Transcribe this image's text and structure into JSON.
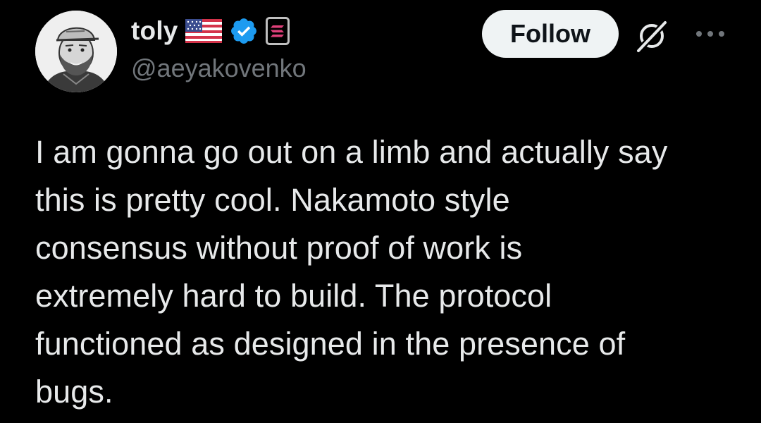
{
  "author": {
    "display_name": "toly",
    "handle": "@aeyakovenko",
    "flag_icon": "us-flag-icon",
    "verified_icon": "verified-badge-icon",
    "affiliate_icon": "solana-badge-icon"
  },
  "actions": {
    "follow_label": "Follow",
    "grok_icon": "grok-icon",
    "more_icon": "more-options-icon"
  },
  "tweet": {
    "text": "I am gonna go out on a limb and actually say\nthis is pretty cool.  Nakamoto style\nconsensus without proof of work is\nextremely hard to build.  The protocol\nfunctioned as designed in the presence of\nbugs."
  },
  "colors": {
    "background": "#000000",
    "text_primary": "#e7e9ea",
    "text_secondary": "#71767b",
    "verified_blue": "#1d9bf0",
    "follow_bg": "#eff3f4",
    "follow_text": "#0f1419"
  }
}
